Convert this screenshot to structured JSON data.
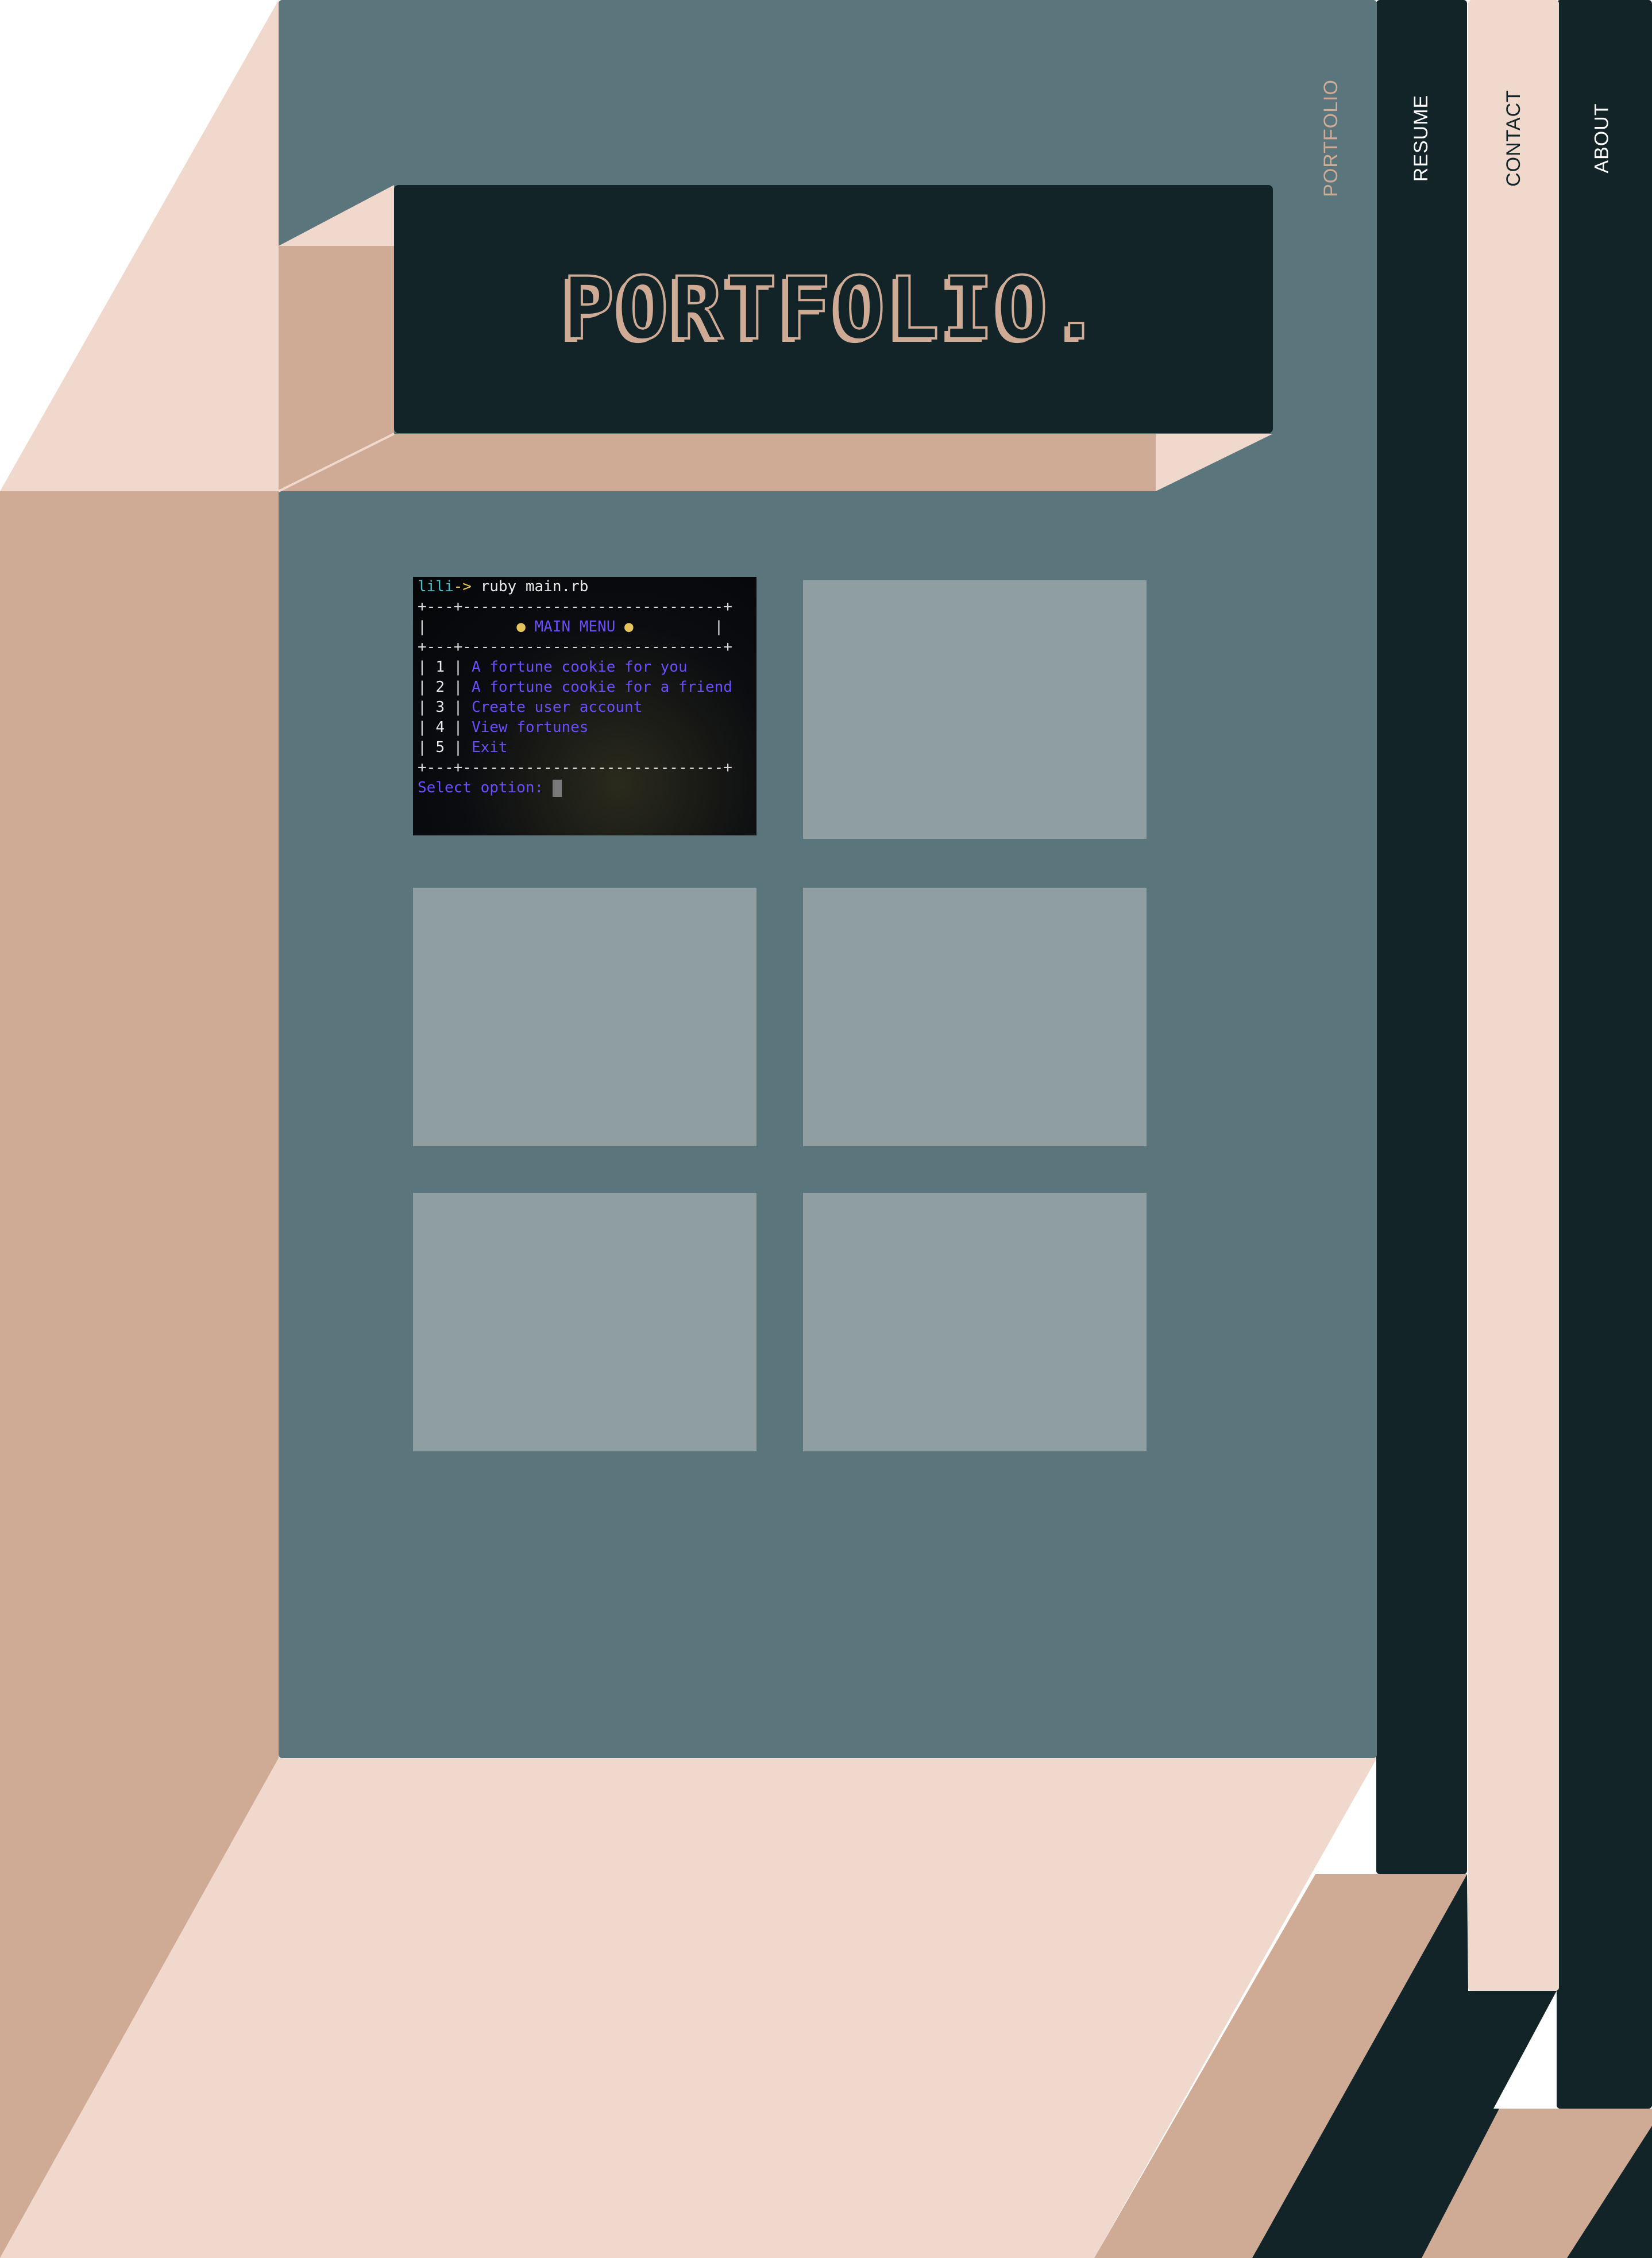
{
  "nav": {
    "portfolio": "PORTFOLIO",
    "resume": "RESUME",
    "contact": "CONTACT",
    "about": "ABOUT"
  },
  "header": {
    "title": "PORTFOLIO."
  },
  "terminal": {
    "prompt_user": "lili",
    "prompt_arrow": "->",
    "command": " ruby main.rb",
    "border": "+---+-----------------------------+",
    "menu_title": "MAIN MENU",
    "items": [
      {
        "num": "1",
        "label": "A fortune cookie for you"
      },
      {
        "num": "2",
        "label": "A fortune cookie for a friend"
      },
      {
        "num": "3",
        "label": "Create user account"
      },
      {
        "num": "4",
        "label": "View fortunes"
      },
      {
        "num": "5",
        "label": "Exit"
      }
    ],
    "select_prompt": "Select option: "
  },
  "colors": {
    "dark": "#122428",
    "teal": "#5a767c",
    "peach_light": "#f0d9cc",
    "peach_dark": "#cfab96",
    "tile": "#8e9ea1"
  }
}
